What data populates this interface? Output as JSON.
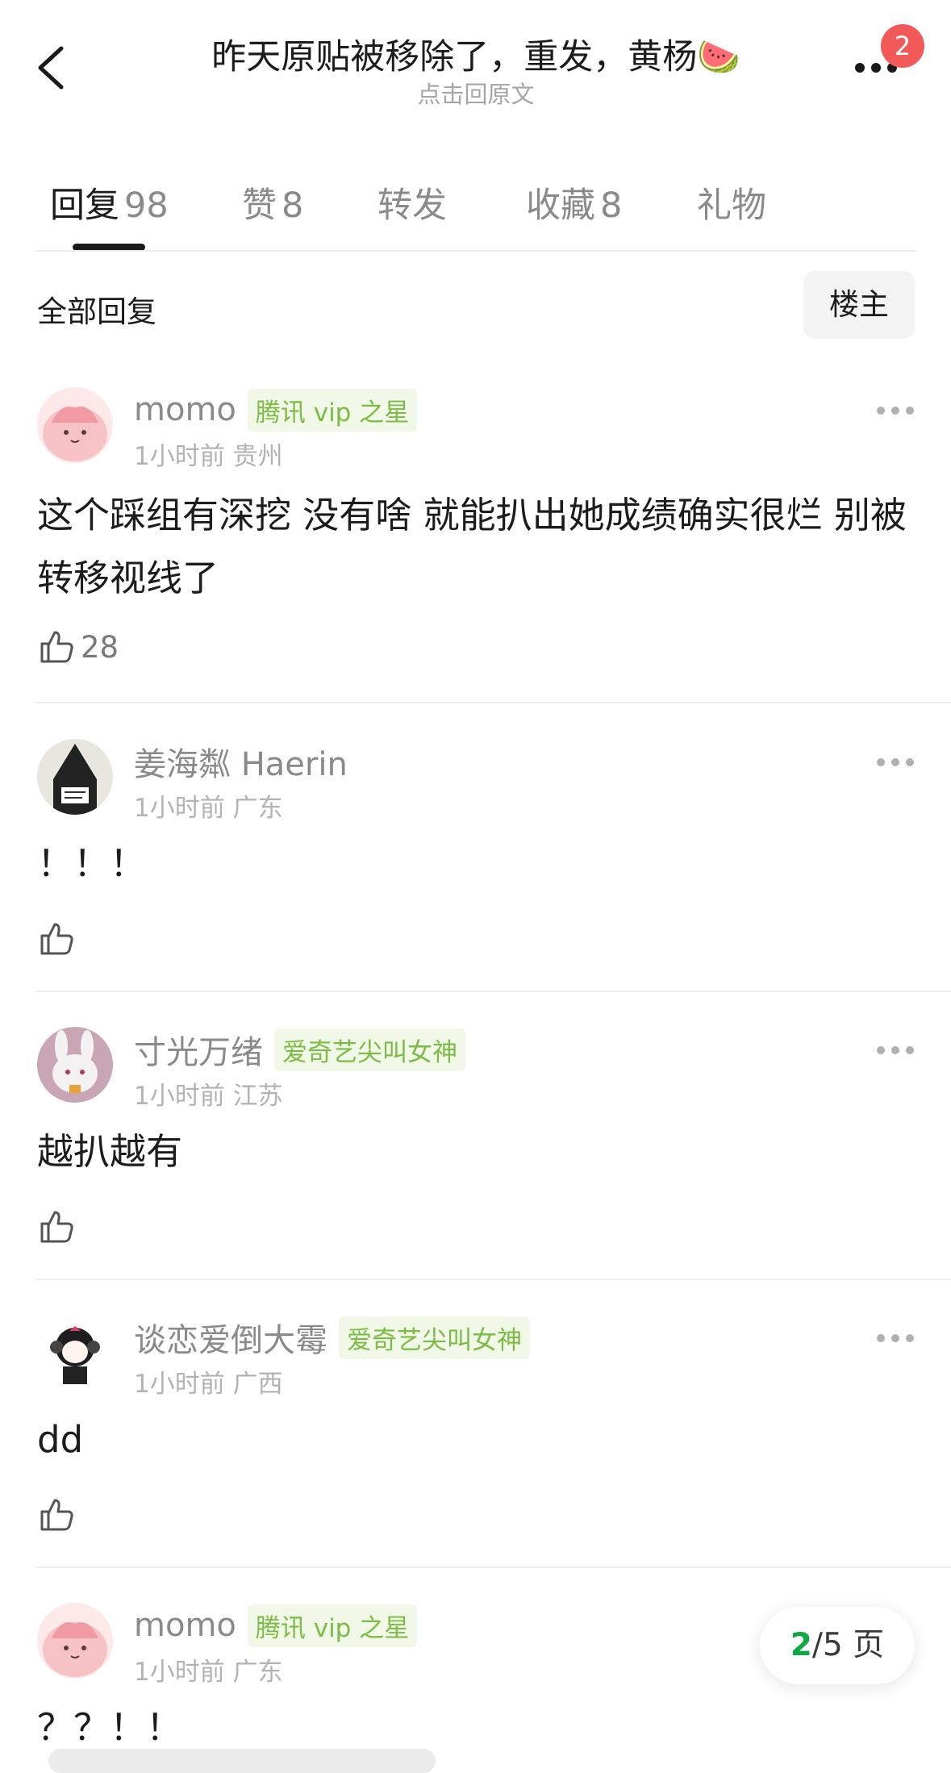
{
  "header": {
    "title": "昨天原贴被移除了，重发，黄杨🍉",
    "subtitle": "点击回原文",
    "more_badge": "2"
  },
  "tabs": [
    {
      "label": "回复",
      "count": "98"
    },
    {
      "label": "赞",
      "count": "8"
    },
    {
      "label": "转发",
      "count": ""
    },
    {
      "label": "收藏",
      "count": "8"
    },
    {
      "label": "礼物",
      "count": ""
    }
  ],
  "filter": {
    "label": "全部回复",
    "author_only": "楼主"
  },
  "comments": [
    {
      "user": "momo",
      "tag": "腾讯 vip 之星",
      "time": "1小时前",
      "location": "贵州",
      "content": "这个踩组有深挖 没有啥 就能扒出她成绩确实很烂 别被转移视线了",
      "likes": "28"
    },
    {
      "user": "姜海粼 Haerin",
      "tag": "",
      "time": "1小时前",
      "location": "广东",
      "content": "！！！",
      "likes": ""
    },
    {
      "user": "寸光万绪",
      "tag": "爱奇艺尖叫女神",
      "time": "1小时前",
      "location": "江苏",
      "content": "越扒越有",
      "likes": ""
    },
    {
      "user": "谈恋爱倒大霉",
      "tag": "爱奇艺尖叫女神",
      "time": "1小时前",
      "location": "广西",
      "content": "dd",
      "likes": ""
    },
    {
      "user": "momo",
      "tag": "腾讯 vip 之星",
      "time": "1小时前",
      "location": "广东",
      "content": "？？！！",
      "likes": ""
    }
  ],
  "pager": {
    "current": "2",
    "total_text": "/5 页"
  },
  "colors": {
    "tag_green": "#7cbb45",
    "pager_green": "#10a843",
    "badge_red": "#f25a5a"
  }
}
